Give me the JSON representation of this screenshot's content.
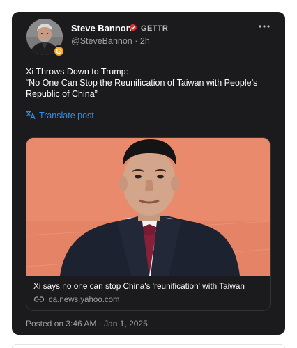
{
  "post": {
    "author": {
      "display_name": "Steve Bannon",
      "platform": "GETTR",
      "handle": "@SteveBannon",
      "separator": " · ",
      "age": "2h",
      "avatar_icon": "person-portrait-icon",
      "verified_icon": "red-verified-badge-icon"
    },
    "text_lines": [
      "Xi Throws Down to Trump:",
      "“No One Can Stop the Reunification of Taiwan with People’s",
      "Republic of China”"
    ],
    "translate_label": "Translate post",
    "link_preview": {
      "headline": "Xi says no one can stop China's 'reunification' with Taiwan",
      "domain": "ca.news.yahoo.com",
      "image_icon": "news-photo-man-in-suit"
    },
    "timestamp": "Posted on 3:46 AM · Jan 1, 2025"
  },
  "colors": {
    "card_background": "#1b1b1d",
    "text_primary": "#ffffff",
    "text_secondary": "#a0a0a4",
    "link_blue": "#2f8ce8",
    "verified_red": "#e0302f",
    "photo_background": "#e98a6d"
  }
}
